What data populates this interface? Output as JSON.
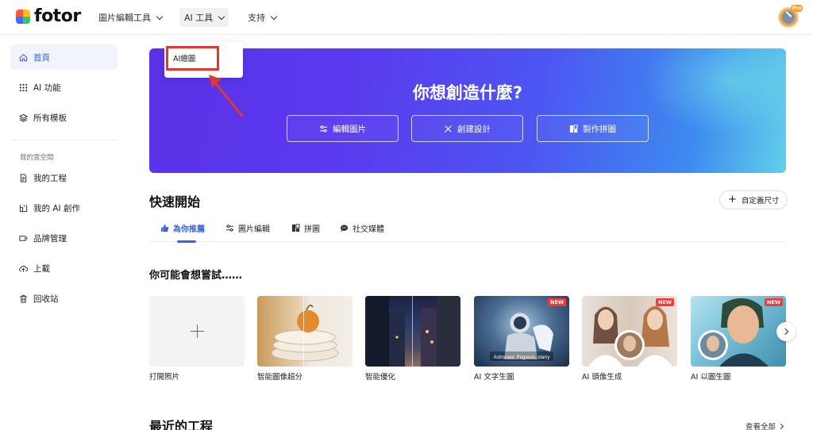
{
  "brand": {
    "name": "fotor",
    "badge": "Pro"
  },
  "nav": [
    {
      "label": "圖片編輯工具"
    },
    {
      "label": "AI 工具"
    },
    {
      "label": "支持"
    }
  ],
  "dropdown": {
    "item": "AI繪圖"
  },
  "sidebar": {
    "items": [
      {
        "label": "首頁",
        "icon": "home-icon"
      },
      {
        "label": "AI 功能",
        "icon": "grid-dots-icon"
      },
      {
        "label": "所有模板",
        "icon": "layers-icon"
      }
    ],
    "section_title": "我的雲空間",
    "cloud_items": [
      {
        "label": "我的工程",
        "icon": "document-icon"
      },
      {
        "label": "我的 AI 創作",
        "icon": "ai-create-icon"
      },
      {
        "label": "品牌管理",
        "icon": "tag-icon"
      },
      {
        "label": "上載",
        "icon": "cloud-upload-icon"
      },
      {
        "label": "回收站",
        "icon": "trash-icon"
      }
    ]
  },
  "banner": {
    "title": "你想創造什麼?",
    "buttons": [
      {
        "label": "編輯圖片",
        "icon": "sliders-icon"
      },
      {
        "label": "創建設計",
        "icon": "pencil-ruler-icon"
      },
      {
        "label": "製作拼圖",
        "icon": "collage-icon"
      }
    ],
    "colors": {
      "start": "#5b32e8",
      "end": "#62d0ea"
    }
  },
  "quick_start": {
    "title": "快速開始",
    "custom_size": "自定義尺寸",
    "tabs": [
      {
        "label": "為你推薦",
        "icon": "thumbs-up-icon",
        "active": true
      },
      {
        "label": "圖片編輯",
        "icon": "sliders-icon",
        "active": false
      },
      {
        "label": "拼圖",
        "icon": "collage-icon",
        "active": false
      },
      {
        "label": "社交媒體",
        "icon": "chat-icon",
        "active": false
      }
    ]
  },
  "suggestions": {
    "title": "你可能會想嘗試……",
    "cards": [
      {
        "label": "打開照片",
        "badge": ""
      },
      {
        "label": "智能圖像超分",
        "badge": ""
      },
      {
        "label": "智能優化",
        "badge": ""
      },
      {
        "label": "AI 文字生圖",
        "badge": "NEW",
        "caption": "Astronaut, Pegasus, starry"
      },
      {
        "label": "AI 頭像生成",
        "badge": "NEW"
      },
      {
        "label": "AI 以圖生圖",
        "badge": "NEW"
      }
    ]
  },
  "recent": {
    "title": "最近的工程",
    "view_all": "查看全部"
  },
  "accent_color": "#3b62e0",
  "highlight_color": "#e2372f"
}
